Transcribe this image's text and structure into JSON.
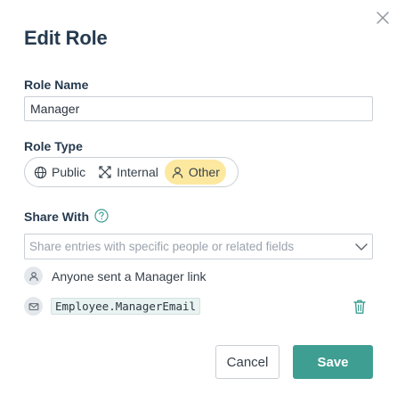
{
  "dialog": {
    "title": "Edit Role"
  },
  "role_name": {
    "label": "Role Name",
    "value": "Manager"
  },
  "role_type": {
    "label": "Role Type",
    "options": [
      {
        "label": "Public",
        "icon": "globe-icon"
      },
      {
        "label": "Internal",
        "icon": "internal-icon"
      },
      {
        "label": "Other",
        "icon": "person-icon"
      }
    ],
    "selected": "Other"
  },
  "share_with": {
    "label": "Share With",
    "placeholder": "Share entries with specific people or related fields",
    "entries": [
      {
        "type": "link",
        "icon": "person-icon",
        "text": "Anyone sent a Manager link"
      },
      {
        "type": "field",
        "icon": "mail-icon",
        "text": "Employee.ManagerEmail"
      }
    ]
  },
  "actions": {
    "cancel_label": "Cancel",
    "save_label": "Save"
  },
  "colors": {
    "accent": "#3f9e92",
    "selected_bg": "#fde8a0",
    "heading": "#263a4f",
    "help_icon": "#3f9e92"
  }
}
